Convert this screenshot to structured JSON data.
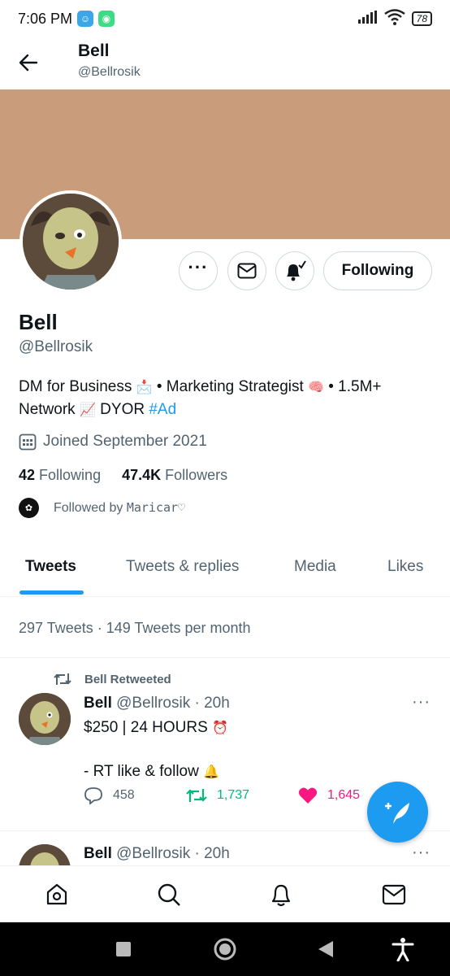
{
  "status_bar": {
    "time": "7:06 PM",
    "battery": "78",
    "icons": [
      "baby-face-app-icon",
      "android-app-icon",
      "signal-icon",
      "wifi-icon",
      "battery-icon"
    ]
  },
  "header": {
    "name": "Bell",
    "handle": "@Bellrosik"
  },
  "profile": {
    "name": "Bell",
    "handle": "@Bellrosik",
    "bio_part1": "DM for Business",
    "bio_sep1": " • ",
    "bio_part2": "Marketing Strategist",
    "bio_sep2": " • 1.5M+",
    "bio_line2a": "Network",
    "bio_line2b": " DYOR ",
    "bio_hashtag": "#Ad",
    "joined": "Joined September 2021",
    "following_count": "42",
    "following_label": "Following",
    "followers_count": "47.4K",
    "followers_label": "Followers",
    "followed_by_prefix": "Followed by",
    "followed_by_name": "Maricar♡",
    "follow_button": "Following"
  },
  "tabs": [
    {
      "label": "Tweets",
      "active": true
    },
    {
      "label": "Tweets & replies",
      "active": false
    },
    {
      "label": "Media",
      "active": false
    },
    {
      "label": "Likes",
      "active": false
    }
  ],
  "tweet_count_text": "297 Tweets · 149 Tweets per month",
  "tweets": [
    {
      "retweet_label": "Bell Retweeted",
      "name": "Bell",
      "meta": " @Bellrosik · 20h",
      "line1": "$250 | 24 HOURS",
      "line2": "- RT like & follow",
      "replies": "458",
      "retweets": "1,737",
      "likes": "1,645"
    },
    {
      "name": "Bell",
      "meta": " @Bellrosik · 20h"
    }
  ],
  "colors": {
    "accent": "#1d9bf0",
    "banner": "#c99d7b",
    "retweet_green": "#00ba7c",
    "like_pink": "#f91880",
    "secondary_text": "#536471"
  }
}
